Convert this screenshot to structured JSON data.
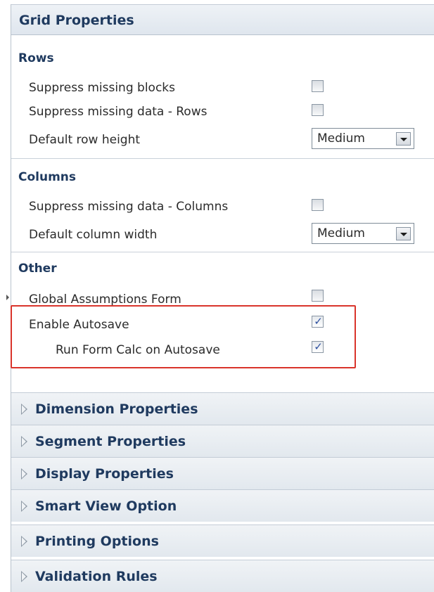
{
  "header": {
    "title": "Grid Properties"
  },
  "rows_section": {
    "title": "Rows",
    "suppress_missing_blocks": {
      "label": "Suppress missing blocks",
      "checked": false
    },
    "suppress_missing_data_rows": {
      "label": "Suppress missing data - Rows",
      "checked": false
    },
    "default_row_height": {
      "label": "Default row height",
      "value": "Medium"
    }
  },
  "columns_section": {
    "title": "Columns",
    "suppress_missing_data_columns": {
      "label": "Suppress missing data - Columns",
      "checked": false
    },
    "default_column_width": {
      "label": "Default column width",
      "value": "Medium"
    }
  },
  "other_section": {
    "title": "Other",
    "global_assumptions_form": {
      "label": "Global Assumptions Form",
      "checked": false
    },
    "enable_autosave": {
      "label": "Enable Autosave",
      "checked": true
    },
    "run_form_calc_on_autosave": {
      "label": "Run Form Calc on Autosave",
      "checked": true
    }
  },
  "collapsed_sections": [
    {
      "label": "Dimension Properties"
    },
    {
      "label": "Segment Properties"
    },
    {
      "label": "Display Properties"
    },
    {
      "label": "Smart View Option"
    },
    {
      "label": "Printing Options"
    },
    {
      "label": "Validation Rules"
    }
  ],
  "colors": {
    "header_text": "#1f3a5f",
    "highlight_border": "#d9342b",
    "checkmark": "#2c4f9e"
  }
}
